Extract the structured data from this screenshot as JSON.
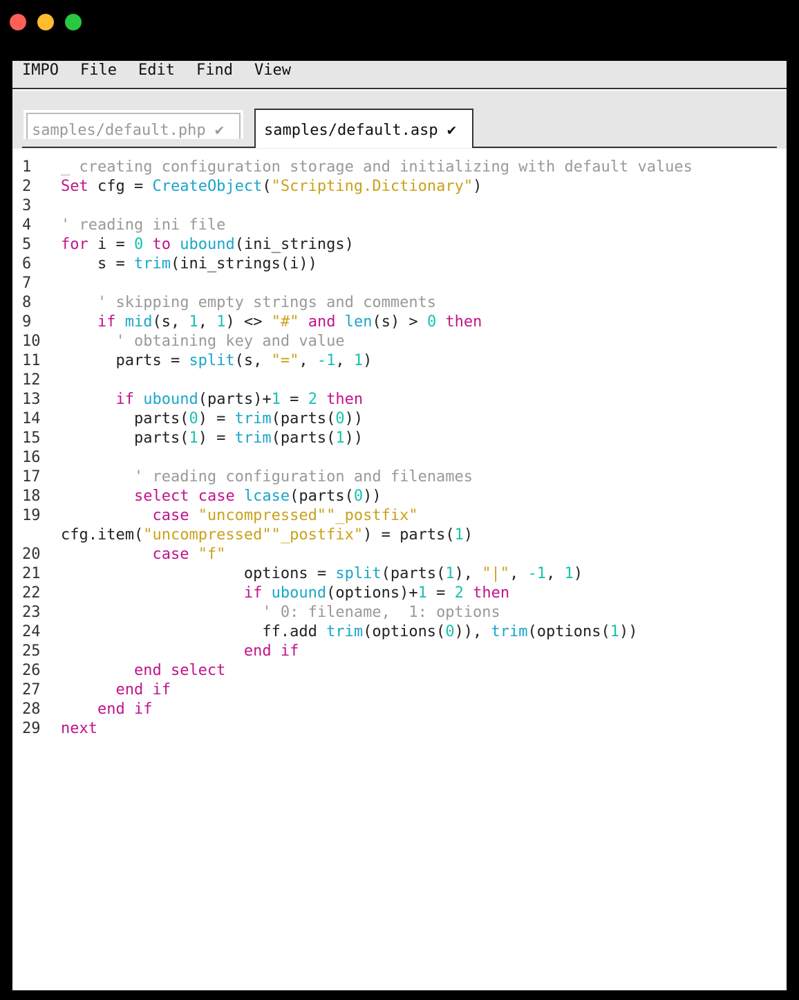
{
  "menu": [
    "IMPO",
    "File",
    "Edit",
    "Find",
    "View"
  ],
  "tabs": [
    {
      "label": "samples/default.php",
      "check": "✔",
      "active": false
    },
    {
      "label": "samples/default.asp",
      "check": "✔",
      "active": true
    }
  ],
  "colors": {
    "keyword": "#c0148a",
    "function": "#1aa6c8",
    "string": "#c9a21b",
    "number": "#17c2ae",
    "comment": "#999999"
  },
  "code_lines": [
    {
      "n": "1",
      "t": [
        [
          "cmt",
          "_ creating configuration storage and initializing with default values"
        ]
      ]
    },
    {
      "n": "2",
      "t": [
        [
          "kw",
          "Set"
        ],
        [
          "",
          " cfg = "
        ],
        [
          "fn",
          "CreateObject"
        ],
        [
          "",
          "("
        ],
        [
          "str",
          "\"Scripting.Dictionary\""
        ],
        [
          "",
          ")"
        ]
      ]
    },
    {
      "n": "3",
      "t": []
    },
    {
      "n": "4",
      "t": [
        [
          "cmt",
          "' reading ini file"
        ]
      ]
    },
    {
      "n": "5",
      "t": [
        [
          "kw",
          "for"
        ],
        [
          "",
          " i = "
        ],
        [
          "num",
          "0"
        ],
        [
          "",
          " "
        ],
        [
          "kw",
          "to"
        ],
        [
          "",
          " "
        ],
        [
          "fn",
          "ubound"
        ],
        [
          "",
          "(ini_strings)"
        ]
      ]
    },
    {
      "n": "6",
      "t": [
        [
          "",
          "    s = "
        ],
        [
          "fn",
          "trim"
        ],
        [
          "",
          "(ini_strings(i))"
        ]
      ]
    },
    {
      "n": "7",
      "t": []
    },
    {
      "n": "8",
      "t": [
        [
          "",
          "    "
        ],
        [
          "cmt",
          "' skipping empty strings and comments"
        ]
      ]
    },
    {
      "n": "9",
      "t": [
        [
          "",
          "    "
        ],
        [
          "kw",
          "if"
        ],
        [
          "",
          " "
        ],
        [
          "fn",
          "mid"
        ],
        [
          "",
          "(s, "
        ],
        [
          "num",
          "1"
        ],
        [
          "",
          ", "
        ],
        [
          "num",
          "1"
        ],
        [
          "",
          ") <> "
        ],
        [
          "str",
          "\"#\""
        ],
        [
          "",
          " "
        ],
        [
          "kw",
          "and"
        ],
        [
          "",
          " "
        ],
        [
          "fn",
          "len"
        ],
        [
          "",
          "(s) > "
        ],
        [
          "num",
          "0"
        ],
        [
          "",
          " "
        ],
        [
          "kw",
          "then"
        ]
      ]
    },
    {
      "n": "10",
      "t": [
        [
          "",
          "      "
        ],
        [
          "cmt",
          "' obtaining key and value"
        ]
      ]
    },
    {
      "n": "11",
      "t": [
        [
          "",
          "      parts = "
        ],
        [
          "fn",
          "split"
        ],
        [
          "",
          "(s, "
        ],
        [
          "str",
          "\"=\""
        ],
        [
          "",
          ", "
        ],
        [
          "num",
          "-1"
        ],
        [
          "",
          ", "
        ],
        [
          "num",
          "1"
        ],
        [
          "",
          ")"
        ]
      ]
    },
    {
      "n": "12",
      "t": []
    },
    {
      "n": "13",
      "t": [
        [
          "",
          "      "
        ],
        [
          "kw",
          "if"
        ],
        [
          "",
          " "
        ],
        [
          "fn",
          "ubound"
        ],
        [
          "",
          "(parts)+"
        ],
        [
          "num",
          "1"
        ],
        [
          "",
          " = "
        ],
        [
          "num",
          "2"
        ],
        [
          "",
          " "
        ],
        [
          "kw",
          "then"
        ]
      ]
    },
    {
      "n": "14",
      "t": [
        [
          "",
          "        parts("
        ],
        [
          "num",
          "0"
        ],
        [
          "",
          ") = "
        ],
        [
          "fn",
          "trim"
        ],
        [
          "",
          "(parts("
        ],
        [
          "num",
          "0"
        ],
        [
          "",
          "))"
        ]
      ]
    },
    {
      "n": "15",
      "t": [
        [
          "",
          "        parts("
        ],
        [
          "num",
          "1"
        ],
        [
          "",
          ") = "
        ],
        [
          "fn",
          "trim"
        ],
        [
          "",
          "(parts("
        ],
        [
          "num",
          "1"
        ],
        [
          "",
          "))"
        ]
      ]
    },
    {
      "n": "16",
      "t": []
    },
    {
      "n": "17",
      "t": [
        [
          "",
          "        "
        ],
        [
          "cmt",
          "' reading configuration and filenames"
        ]
      ]
    },
    {
      "n": "18",
      "t": [
        [
          "",
          "        "
        ],
        [
          "kw",
          "select"
        ],
        [
          "",
          " "
        ],
        [
          "kw",
          "case"
        ],
        [
          "",
          " "
        ],
        [
          "fn",
          "lcase"
        ],
        [
          "",
          "(parts("
        ],
        [
          "num",
          "0"
        ],
        [
          "",
          "))"
        ]
      ]
    },
    {
      "n": "19",
      "t": [
        [
          "",
          "          "
        ],
        [
          "kw",
          "case"
        ],
        [
          "",
          " "
        ],
        [
          "str",
          "\"uncompressed\"\"_postfix\""
        ]
      ]
    },
    {
      "n": "",
      "t": [
        [
          "",
          "cfg.item("
        ],
        [
          "str",
          "\"uncompressed\"\"_postfix\""
        ],
        [
          "",
          ") = parts("
        ],
        [
          "num",
          "1"
        ],
        [
          "",
          ")"
        ]
      ]
    },
    {
      "n": "20",
      "t": [
        [
          "",
          "          "
        ],
        [
          "kw",
          "case"
        ],
        [
          "",
          " "
        ],
        [
          "str",
          "\"f\""
        ]
      ]
    },
    {
      "n": "21",
      "t": [
        [
          "",
          "                    options = "
        ],
        [
          "fn",
          "split"
        ],
        [
          "",
          "(parts("
        ],
        [
          "num",
          "1"
        ],
        [
          "",
          "), "
        ],
        [
          "str",
          "\"|\""
        ],
        [
          "",
          ", "
        ],
        [
          "num",
          "-1"
        ],
        [
          "",
          ", "
        ],
        [
          "num",
          "1"
        ],
        [
          "",
          ")"
        ]
      ]
    },
    {
      "n": "22",
      "t": [
        [
          "",
          "                    "
        ],
        [
          "kw",
          "if"
        ],
        [
          "",
          " "
        ],
        [
          "fn",
          "ubound"
        ],
        [
          "",
          "(options)+"
        ],
        [
          "num",
          "1"
        ],
        [
          "",
          " = "
        ],
        [
          "num",
          "2"
        ],
        [
          "",
          " "
        ],
        [
          "kw",
          "then"
        ]
      ]
    },
    {
      "n": "23",
      "t": [
        [
          "",
          "                      "
        ],
        [
          "cmt",
          "' 0: filename,  1: options"
        ]
      ]
    },
    {
      "n": "24",
      "t": [
        [
          "",
          "                      ff.add "
        ],
        [
          "fn",
          "trim"
        ],
        [
          "",
          "(options("
        ],
        [
          "num",
          "0"
        ],
        [
          "",
          ")), "
        ],
        [
          "fn",
          "trim"
        ],
        [
          "",
          "(options("
        ],
        [
          "num",
          "1"
        ],
        [
          "",
          "))"
        ]
      ]
    },
    {
      "n": "25",
      "t": [
        [
          "",
          "                    "
        ],
        [
          "kw",
          "end if"
        ]
      ]
    },
    {
      "n": "26",
      "t": [
        [
          "",
          "        "
        ],
        [
          "kw",
          "end select"
        ]
      ]
    },
    {
      "n": "27",
      "t": [
        [
          "",
          "      "
        ],
        [
          "kw",
          "end if"
        ]
      ]
    },
    {
      "n": "28",
      "t": [
        [
          "",
          "    "
        ],
        [
          "kw",
          "end if"
        ]
      ]
    },
    {
      "n": "29",
      "t": [
        [
          "kw",
          "next"
        ]
      ]
    }
  ]
}
